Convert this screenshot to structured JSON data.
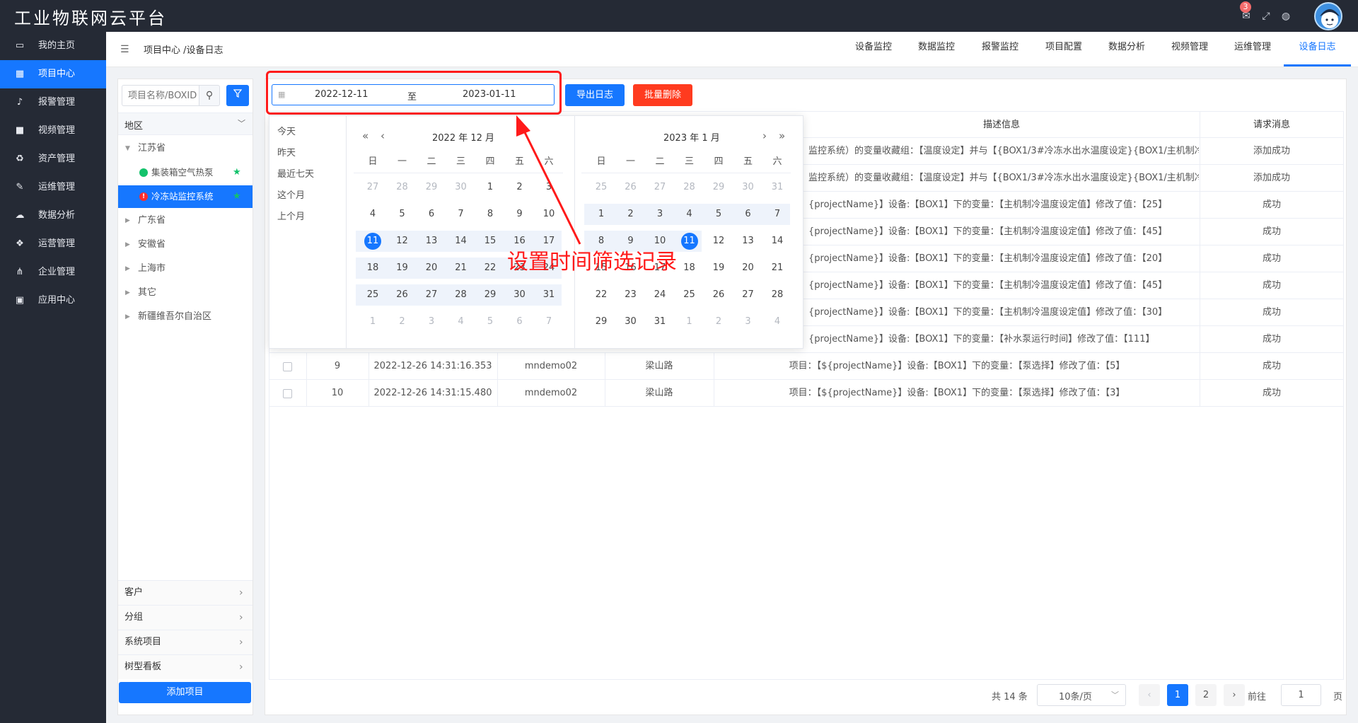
{
  "app": {
    "title": "工业物联网云平台",
    "mail_count": "3"
  },
  "sidebar": {
    "items": [
      {
        "label": "我的主页",
        "icon": "laptop-icon"
      },
      {
        "label": "项目中心",
        "icon": "grid-icon"
      },
      {
        "label": "报警管理",
        "icon": "bell-icon"
      },
      {
        "label": "视频管理",
        "icon": "video-icon"
      },
      {
        "label": "资产管理",
        "icon": "recycle-icon"
      },
      {
        "label": "运维管理",
        "icon": "wrench-icon"
      },
      {
        "label": "数据分析",
        "icon": "cloud-icon"
      },
      {
        "label": "运营管理",
        "icon": "cubes-icon"
      },
      {
        "label": "企业管理",
        "icon": "sitemap-icon"
      },
      {
        "label": "应用中心",
        "icon": "apps-icon"
      }
    ],
    "active_index": 1
  },
  "breadcrumb": "项目中心 /设备日志",
  "nav_tabs": [
    "设备监控",
    "数据监控",
    "报警监控",
    "项目配置",
    "数据分析",
    "视频管理",
    "运维管理",
    "设备日志"
  ],
  "left_panel": {
    "search_placeholder": "项目名称/BOXID",
    "region_label": "地区",
    "tree": {
      "jiangsu": "江苏省",
      "child1": "集装箱空气热泵",
      "child2": "冷冻站监控系统",
      "guangdong": "广东省",
      "anhui": "安徽省",
      "shanghai": "上海市",
      "other": "其它",
      "xinjiang": "新疆维吾尔自治区"
    },
    "accordion": [
      "客户",
      "分组",
      "系统项目",
      "树型看板"
    ],
    "add_button": "添加项目"
  },
  "toolbar": {
    "date_start": "2022-12-11",
    "date_sep": "至",
    "date_end": "2023-01-11",
    "export_label": "导出日志",
    "delete_label": "批量删除"
  },
  "table": {
    "headers": {
      "desc": "描述信息",
      "result": "请求消息"
    },
    "rows": [
      {
        "desc": "监控系统）的变量收藏组：【温度设定】并与【{BOX1/3#冷冻水出水温度设定}{BOX1/主机制冷温度设定值}】",
        "result": "添加成功"
      },
      {
        "desc": "监控系统）的变量收藏组：【温度设定】并与【{BOX1/3#冷冻水出水温度设定}{BOX1/主机制冷温度设定值}】",
        "result": "添加成功"
      },
      {
        "desc": "{projectName}】设备:【BOX1】下的变量：【主机制冷温度设定值】修改了值：【25】",
        "result": "成功"
      },
      {
        "desc": "{projectName}】设备:【BOX1】下的变量：【主机制冷温度设定值】修改了值：【45】",
        "result": "成功"
      },
      {
        "desc": "{projectName}】设备:【BOX1】下的变量：【主机制冷温度设定值】修改了值：【20】",
        "result": "成功"
      },
      {
        "desc": "{projectName}】设备:【BOX1】下的变量：【主机制冷温度设定值】修改了值：【45】",
        "result": "成功"
      },
      {
        "desc": "{projectName}】设备:【BOX1】下的变量：【主机制冷温度设定值】修改了值：【30】",
        "result": "成功"
      },
      {
        "desc": "{projectName}】设备:【BOX1】下的变量：【补水泵运行时间】修改了值：【111】",
        "result": "成功"
      }
    ],
    "full_rows": [
      {
        "index": "9",
        "time": "2022-12-26 14:31:16.353",
        "user": "mndemo02",
        "location": "梁山路",
        "desc": "项目：【${projectName}】设备:【BOX1】下的变量：【泵选择】修改了值：【5】",
        "result": "成功"
      },
      {
        "index": "10",
        "time": "2022-12-26 14:31:15.480",
        "user": "mndemo02",
        "location": "梁山路",
        "desc": "项目：【${projectName}】设备:【BOX1】下的变量：【泵选择】修改了值：【3】",
        "result": "成功"
      }
    ]
  },
  "picker": {
    "shortcuts": [
      "今天",
      "昨天",
      "最近七天",
      "这个月",
      "上个月"
    ],
    "left_title": "2022 年 12 月",
    "right_title": "2023 年 1 月",
    "weekdays": [
      "日",
      "一",
      "二",
      "三",
      "四",
      "五",
      "六"
    ],
    "left_days": [
      "27",
      "28",
      "29",
      "30",
      "1",
      "2",
      "3",
      "4",
      "5",
      "6",
      "7",
      "8",
      "9",
      "10",
      "11",
      "12",
      "13",
      "14",
      "15",
      "16",
      "17",
      "18",
      "19",
      "20",
      "21",
      "22",
      "23",
      "24",
      "25",
      "26",
      "27",
      "28",
      "29",
      "30",
      "31",
      "1",
      "2",
      "3",
      "4",
      "5",
      "6",
      "7"
    ],
    "left_muted": [
      0,
      1,
      2,
      3,
      35,
      36,
      37,
      38,
      39,
      40,
      41
    ],
    "left_selected": 14,
    "left_range_start": 14,
    "left_range_end": 34,
    "right_days": [
      "25",
      "26",
      "27",
      "28",
      "29",
      "30",
      "31",
      "1",
      "2",
      "3",
      "4",
      "5",
      "6",
      "7",
      "8",
      "9",
      "10",
      "11",
      "12",
      "13",
      "14",
      "15",
      "16",
      "17",
      "18",
      "19",
      "20",
      "21",
      "22",
      "23",
      "24",
      "25",
      "26",
      "27",
      "28",
      "29",
      "30",
      "31",
      "1",
      "2",
      "3",
      "4"
    ],
    "right_muted": [
      0,
      1,
      2,
      3,
      4,
      5,
      6,
      38,
      39,
      40,
      41
    ],
    "right_selected": 17,
    "right_range_start": 7,
    "right_range_end": 17
  },
  "annotation": "设置时间筛选记录",
  "pagination": {
    "total": "共 14 条",
    "page_size": "10条/页",
    "pages": [
      "1",
      "2"
    ],
    "current": "1",
    "goto_label": "前往",
    "goto_value": "1",
    "suffix": "页",
    "prev": "‹",
    "next": "›"
  },
  "colors": {
    "primary": "#1677ff",
    "danger": "#ff3b1f",
    "sidebar_bg": "#252a35",
    "annotation": "#ff1a1a"
  }
}
